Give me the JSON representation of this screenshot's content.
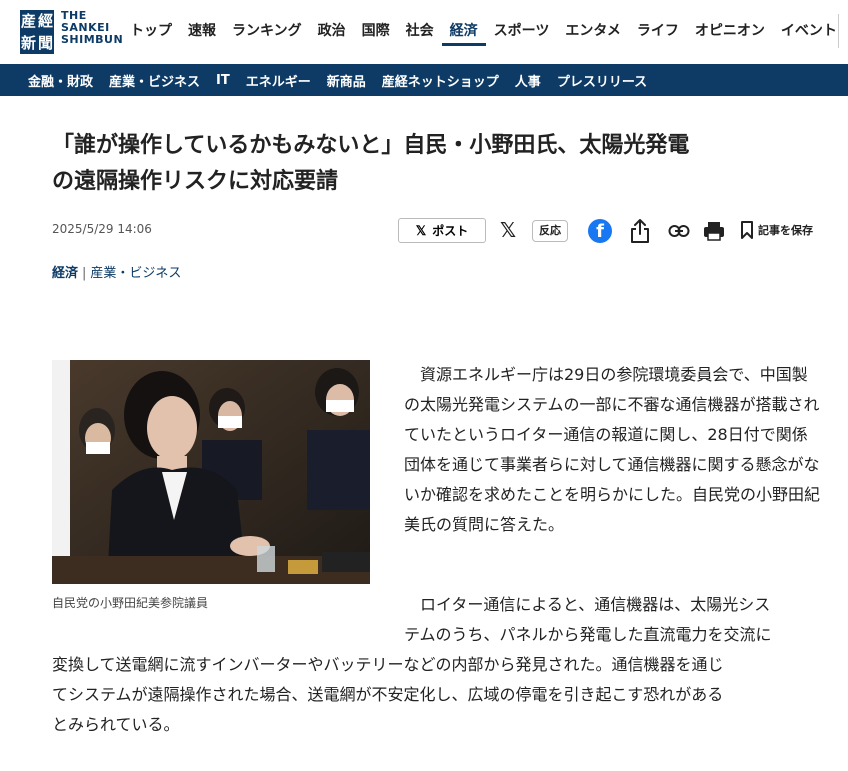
{
  "logo": {
    "kanji": [
      "産",
      "經",
      "新",
      "聞"
    ],
    "english": [
      "THE",
      "SANKEI",
      "SHIMBUN"
    ]
  },
  "main_nav": [
    {
      "label": "トップ",
      "active": false
    },
    {
      "label": "速報",
      "active": false
    },
    {
      "label": "ランキング",
      "active": false
    },
    {
      "label": "政治",
      "active": false
    },
    {
      "label": "国際",
      "active": false
    },
    {
      "label": "社会",
      "active": false
    },
    {
      "label": "経済",
      "active": true
    },
    {
      "label": "スポーツ",
      "active": false
    },
    {
      "label": "エンタメ",
      "active": false
    },
    {
      "label": "ライフ",
      "active": false
    },
    {
      "label": "オピニオン",
      "active": false
    },
    {
      "label": "イベント",
      "active": false
    }
  ],
  "sub_nav": [
    "金融・財政",
    "産業・ビジネス",
    "IT",
    "エネルギー",
    "新商品",
    "産経ネットショップ",
    "人事",
    "プレスリリース"
  ],
  "article": {
    "headline_line1": "「誰が操作しているかもみないと」自民・小野田氏、太陽光発電",
    "headline_line2": "の遠隔操作リスクに対応要請",
    "date": "2025/5/29 14:06",
    "tag_primary": "経済",
    "tag_separator": "|",
    "tag_secondary": "産業・ビジネス",
    "photo_caption": "自民党の小野田紀美参院議員",
    "paragraph1": "資源エネルギー庁は29日の参院環境委員会で、中国製の太陽光発電システムの一部に不審な通信機器が搭載されていたというロイター通信の報道に関し、28日付で関係団体を通じて事業者らに対して通信機器に関する懸念がないか確認を求めたことを明らかにした。自民党の小野田紀美氏の質問に答えた。",
    "paragraph2_line1": "　　　　　　　　　　　　　　　　　　　　　　　　ロイター通信によると、通信機器は、太陽光シス",
    "paragraph2_line2": "　　　　　　　　　　　　　　　　　　　　　　　　テムのうち、パネルから発電した直流電力を交流に",
    "paragraph2_line3": "変換して送電網に流すインバーターやバッテリーなどの内部から発見された。通信機器を通じ",
    "paragraph2_line4": "てシステムが遠隔操作された場合、送電網が不安定化し、広域の停電を引き起こす恐れがある",
    "paragraph2_line5": "とみられている。"
  },
  "share": {
    "post_label": "ポスト",
    "post_icon": "x-logo-icon",
    "x_icon": "x-logo-icon",
    "reply_label": "反応",
    "facebook_icon": "facebook-icon",
    "share_icon": "share-icon",
    "link_icon": "link-icon",
    "print_icon": "print-icon",
    "save_icon": "bookmark-icon",
    "save_label": "記事を保存"
  },
  "colors": {
    "brand_navy": "#0d3b66",
    "facebook_blue": "#1877f2"
  }
}
